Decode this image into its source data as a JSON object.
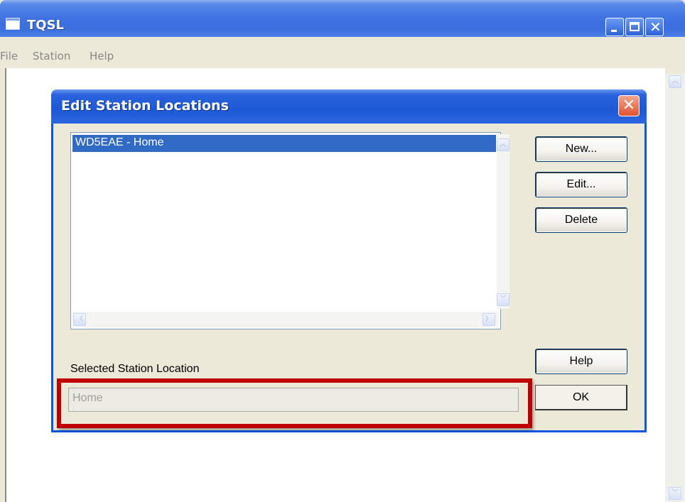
{
  "window": {
    "title": "TQSL"
  },
  "menu": {
    "file": "File",
    "station": "Station",
    "help": "Help"
  },
  "dialog": {
    "title": "Edit Station Locations",
    "list_items": [
      "WD5EAE - Home"
    ],
    "buttons": {
      "new": "New...",
      "edit": "Edit...",
      "delete": "Delete",
      "help": "Help",
      "ok": "OK"
    },
    "selected_label": "Selected Station Location",
    "selected_value": "Home"
  },
  "icons": {
    "minimize": "minimize-icon",
    "maximize": "maximize-icon",
    "close": "close-icon",
    "scroll_up": "chevron-up-icon",
    "scroll_down": "chevron-down-icon",
    "scroll_left": "chevron-left-icon",
    "scroll_right": "chevron-right-icon"
  },
  "colors": {
    "titlebar": "#3e72e0",
    "selection": "#316ac5",
    "highlight_frame": "#c00000",
    "dialog_close": "#e05330"
  }
}
